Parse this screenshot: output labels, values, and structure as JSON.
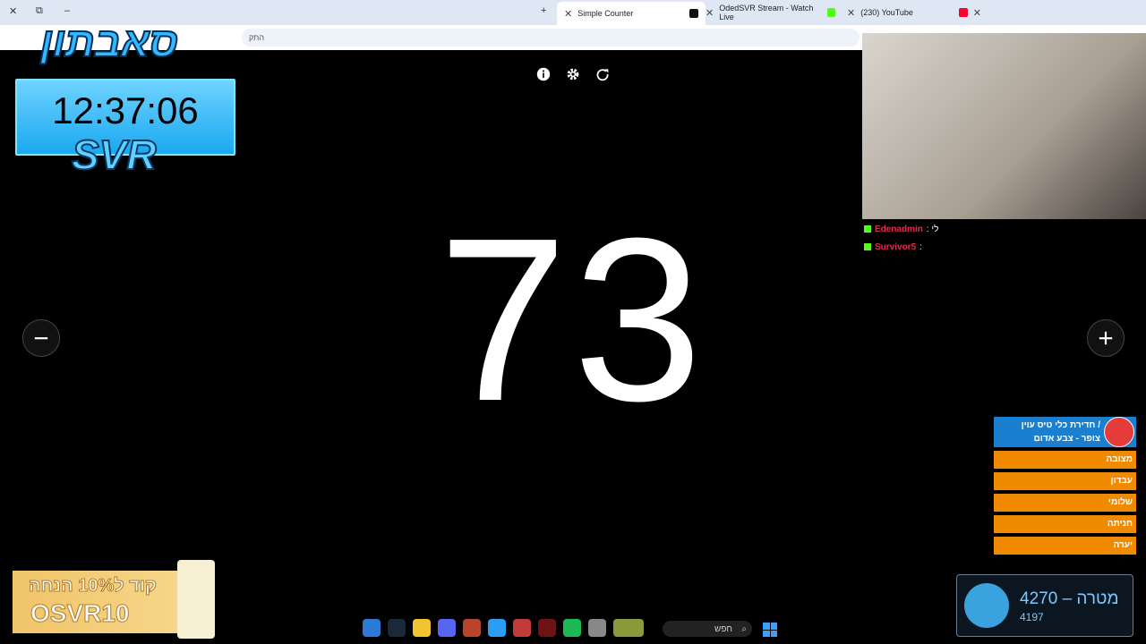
{
  "browser": {
    "tabs": [
      {
        "title": "Simple Counter",
        "active": true
      },
      {
        "title": "OdedSVR Stream - Watch Live",
        "active": false
      },
      {
        "title": "(230) YouTube",
        "active": false
      }
    ],
    "address_hint": "התק"
  },
  "counter": {
    "value": "73"
  },
  "overlay": {
    "brand": "סאבתון",
    "clock": "12:37:06",
    "channel": "SVR",
    "chat": [
      {
        "user": "Edenadmin",
        "text": ": לי"
      },
      {
        "user": "Survivor5",
        "text": ":"
      }
    ],
    "poll": {
      "title_line1": "חדירת כלי טיס עוין /",
      "title_line2": "צופר - צבע אדום",
      "options": [
        "מצובה",
        "עבדון",
        "שלומי",
        "חניתה",
        "יערה"
      ]
    },
    "goal": {
      "label": "מטרה",
      "target": "4270",
      "current": "4197"
    },
    "promo": {
      "line1": "קוד ל10% הנחה",
      "code": "OSVR10"
    }
  },
  "taskbar": {
    "search_label": "חפש"
  },
  "colors": {
    "background": "#000000",
    "counter_text": "#ffffff",
    "poll_header": "#1b7fd0",
    "poll_option": "#f08a00",
    "chat_user": "#e12b4c"
  }
}
